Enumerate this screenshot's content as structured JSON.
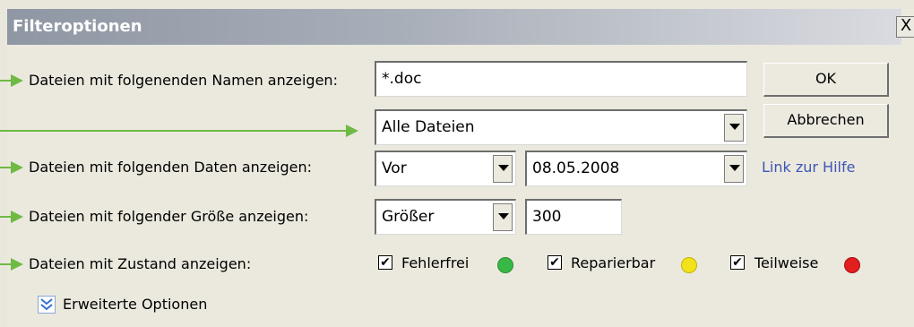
{
  "window": {
    "title": "Filteroptionen",
    "close_label": "X"
  },
  "rows": {
    "name_label": "Dateien mit folgenenden Namen anzeigen:",
    "name_value": "*.doc",
    "type_value": "Alle Dateien",
    "date_label": "Dateien mit folgenden Daten anzeigen:",
    "date_mode": "Vor",
    "date_value": "08.05.2008",
    "size_label": "Dateien mit folgender Größe anzeigen:",
    "size_mode": "Größer",
    "size_value": "300",
    "state_label": "Dateien mit Zustand anzeigen:"
  },
  "states": [
    {
      "label": "Fehlerfrei",
      "checked": true,
      "color": "#38b846"
    },
    {
      "label": "Reparierbar",
      "checked": true,
      "color": "#f2e21a"
    },
    {
      "label": "Teilweise",
      "checked": true,
      "color": "#e21e1e"
    }
  ],
  "buttons": {
    "ok": "OK",
    "cancel": "Abbrechen"
  },
  "help_link": "Link zur Hilfe",
  "advanced": "Erweiterte Optionen",
  "checkmark": "✔",
  "colors": {
    "annotation_arrow": "#6fba44",
    "link": "#3e55b6"
  }
}
